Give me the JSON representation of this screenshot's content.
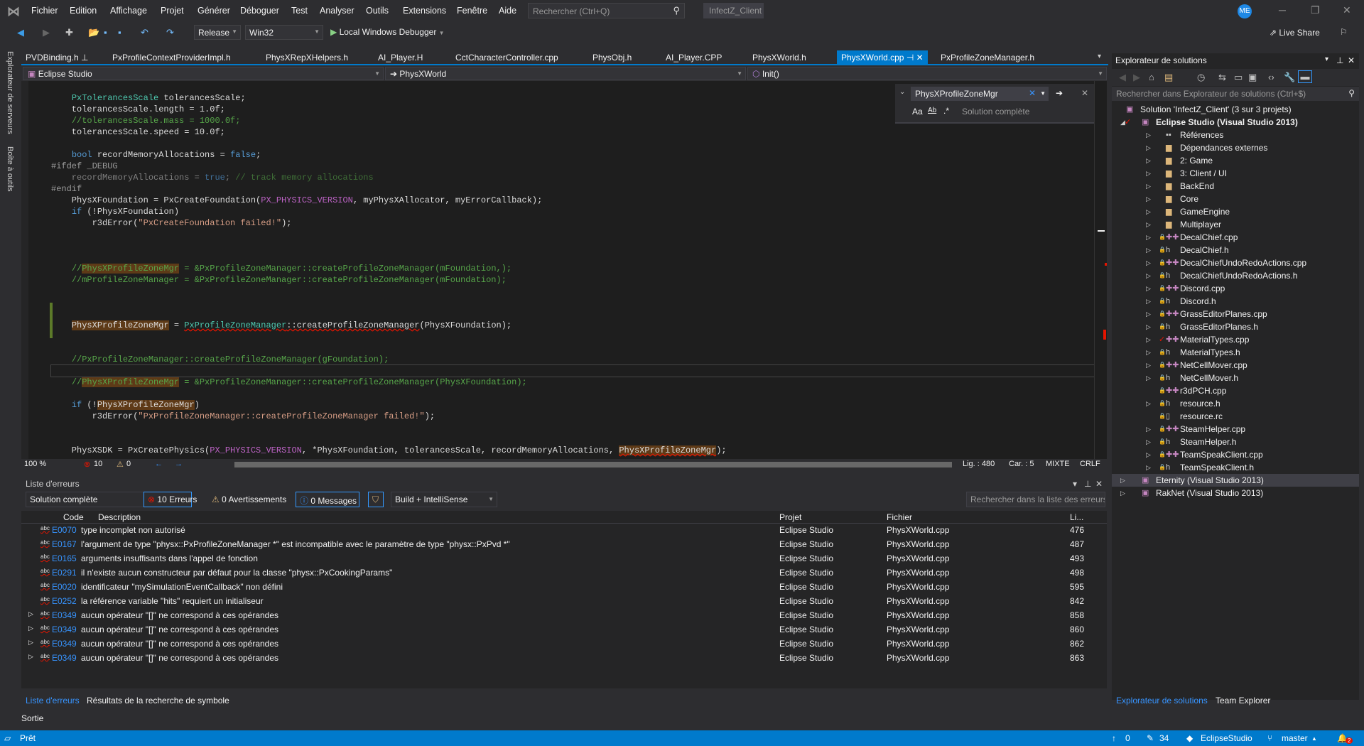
{
  "menubar": {
    "items": [
      "Fichier",
      "Edition",
      "Affichage",
      "Projet",
      "Générer",
      "Déboguer",
      "Test",
      "Analyser",
      "Outils",
      "Extensions",
      "Fenêtre",
      "Aide"
    ],
    "search_placeholder": "Rechercher (Ctrl+Q)",
    "solution_name": "InfectZ_Client",
    "avatar_initials": "ME"
  },
  "toolbar": {
    "configuration": "Release",
    "platform": "Win32",
    "debugger": "Local Windows Debugger",
    "live_share": "Live Share"
  },
  "left_strip": {
    "server_explorer": "Explorateur de serveurs",
    "toolbox": "Boîte à outils"
  },
  "tabs": [
    {
      "label": "PVDBinding.h",
      "pinned": true
    },
    {
      "label": "PxProfileContextProviderImpl.h"
    },
    {
      "label": "PhysXRepXHelpers.h"
    },
    {
      "label": "AI_Player.H"
    },
    {
      "label": "CctCharacterController.cpp"
    },
    {
      "label": "PhysObj.h"
    },
    {
      "label": "AI_Player.CPP"
    },
    {
      "label": "PhysXWorld.h"
    },
    {
      "label": "PhysXWorld.cpp",
      "active": true
    },
    {
      "label": "PxProfileZoneManager.h"
    }
  ],
  "navbar": {
    "project": "Eclipse Studio",
    "scope": "PhysXWorld",
    "member": "Init()"
  },
  "find": {
    "query": "PhysXProfileZoneMgr",
    "scope": "Solution complète",
    "match_case": "Aa",
    "whole_word": "Ab"
  },
  "code_lines": [
    [
      [
        "    ",
        ""
      ],
      [
        "PxTolerancesScale",
        "t-type"
      ],
      [
        " tolerancesScale;",
        "t-id"
      ]
    ],
    [
      [
        "    tolerancesScale.length = 1.0f;",
        "t-id"
      ]
    ],
    [
      [
        "    ",
        ""
      ],
      [
        "//tolerancesScale.mass = 1000.0f;",
        "t-cm"
      ]
    ],
    [
      [
        "    tolerancesScale.speed = 10.0f;",
        "t-id"
      ]
    ],
    [],
    [
      [
        "    ",
        ""
      ],
      [
        "bool",
        "t-kw"
      ],
      [
        " recordMemoryAllocations = ",
        "t-id"
      ],
      [
        "false",
        "t-kw"
      ],
      [
        ";",
        "t-id"
      ]
    ],
    [
      [
        "#ifdef _DEBUG",
        "t-pp"
      ]
    ],
    [
      [
        "    recordMemoryAllocations = ",
        "t-dim"
      ],
      [
        "true",
        "t-dimkw"
      ],
      [
        "; ",
        "t-dim"
      ],
      [
        "// track memory allocations",
        "t-dimcm"
      ]
    ],
    [
      [
        "#endif",
        "t-pp"
      ]
    ],
    [
      [
        "    PhysXFoundation = PxCreateFoundation(",
        "t-id"
      ],
      [
        "PX_PHYSICS_VERSION",
        "t-mac"
      ],
      [
        ", myPhysXAllocator, myErrorCallback);",
        "t-id"
      ]
    ],
    [
      [
        "    ",
        ""
      ],
      [
        "if",
        "t-kw"
      ],
      [
        " (!PhysXFoundation)",
        "t-id"
      ]
    ],
    [
      [
        "        r3dError(",
        "t-id"
      ],
      [
        "\"PxCreateFoundation failed!\"",
        "t-str"
      ],
      [
        ");",
        "t-id"
      ]
    ],
    [],
    [],
    [],
    [
      [
        "    ",
        ""
      ],
      [
        "//",
        "t-cm"
      ],
      [
        "PhysXProfileZoneMgr",
        "t-cm hl"
      ],
      [
        " = &PxProfileZoneManager::createProfileZoneManager(mFoundation,);",
        "t-cm"
      ]
    ],
    [
      [
        "    ",
        ""
      ],
      [
        "//mProfileZoneManager = &PxProfileZoneManager::createProfileZoneManager(mFoundation);",
        "t-cm"
      ]
    ],
    [],
    [],
    [],
    [
      [
        "    ",
        ""
      ],
      [
        "PhysXProfileZoneMgr",
        "t-id hl"
      ],
      [
        " = ",
        "t-id"
      ],
      [
        "PxProfileZoneManager",
        "t-type sq"
      ],
      [
        "::createProfileZoneManager",
        "t-id sq"
      ],
      [
        "(PhysXFoundation);",
        "t-id"
      ]
    ],
    [],
    [],
    [
      [
        "    ",
        ""
      ],
      [
        "//PxProfileZoneManager::createProfileZoneManager(gFoundation);",
        "t-cm"
      ]
    ],
    [],
    [
      [
        "    ",
        ""
      ],
      [
        "//",
        "t-cm"
      ],
      [
        "PhysXProfileZoneMgr",
        "t-cm hl"
      ],
      [
        " = &PxProfileZoneManager::createProfileZoneManager(PhysXFoundation);",
        "t-cm"
      ]
    ],
    [],
    [
      [
        "    ",
        ""
      ],
      [
        "if",
        "t-kw"
      ],
      [
        " (!",
        "t-id"
      ],
      [
        "PhysXProfileZoneMgr",
        "t-id hl"
      ],
      [
        ")",
        "t-id"
      ]
    ],
    [
      [
        "        r3dError(",
        "t-id"
      ],
      [
        "\"PxProfileZoneManager::createProfileZoneManager failed!\"",
        "t-str"
      ],
      [
        ");",
        "t-id"
      ]
    ],
    [],
    [],
    [
      [
        "    PhysXSDK = PxCreatePhysics(",
        "t-id"
      ],
      [
        "PX_PHYSICS_VERSION",
        "t-mac"
      ],
      [
        ", *PhysXFoundation, tolerancesScale, recordMemoryAllocations, ",
        "t-id"
      ],
      [
        "PhysXProfileZoneMgr",
        "t-id hl sq"
      ],
      [
        ");",
        "t-id"
      ]
    ]
  ],
  "editor_status": {
    "zoom": "100 %",
    "errors": "10",
    "warnings": "0",
    "line": "Lig. : 480",
    "col": "Car. : 5",
    "mode": "MIXTE",
    "eol": "CRLF"
  },
  "error_list": {
    "title": "Liste d'erreurs",
    "scope": "Solution complète",
    "errors_btn": "10 Erreurs",
    "warnings_btn": "0 Avertissements",
    "messages_btn": "0 Messages",
    "source": "Build + IntelliSense",
    "search_placeholder": "Rechercher dans la liste des erreurs",
    "columns": {
      "code": "Code",
      "description": "Description",
      "project": "Projet",
      "file": "Fichier",
      "line": "Li..."
    },
    "rows": [
      {
        "code": "E0070",
        "desc": "type incomplet non autorisé",
        "project": "Eclipse Studio",
        "file": "PhysXWorld.cpp",
        "line": "476"
      },
      {
        "code": "E0167",
        "desc": "l'argument de type \"physx::PxProfileZoneManager *\" est incompatible avec le paramètre de type \"physx::PxPvd *\"",
        "project": "Eclipse Studio",
        "file": "PhysXWorld.cpp",
        "line": "487"
      },
      {
        "code": "E0165",
        "desc": "arguments insuffisants dans l'appel de fonction",
        "project": "Eclipse Studio",
        "file": "PhysXWorld.cpp",
        "line": "493"
      },
      {
        "code": "E0291",
        "desc": "il n'existe aucun constructeur par défaut pour la classe \"physx::PxCookingParams\"",
        "project": "Eclipse Studio",
        "file": "PhysXWorld.cpp",
        "line": "498"
      },
      {
        "code": "E0020",
        "desc": "identificateur \"mySimulationEventCallback\" non défini",
        "project": "Eclipse Studio",
        "file": "PhysXWorld.cpp",
        "line": "595"
      },
      {
        "code": "E0252",
        "desc": "la référence variable \"hits\" requiert un initialiseur",
        "project": "Eclipse Studio",
        "file": "PhysXWorld.cpp",
        "line": "842"
      },
      {
        "code": "E0349",
        "desc": "aucun opérateur \"[]\" ne correspond à ces opérandes",
        "project": "Eclipse Studio",
        "file": "PhysXWorld.cpp",
        "line": "858",
        "expandable": true
      },
      {
        "code": "E0349",
        "desc": "aucun opérateur \"[]\" ne correspond à ces opérandes",
        "project": "Eclipse Studio",
        "file": "PhysXWorld.cpp",
        "line": "860",
        "expandable": true
      },
      {
        "code": "E0349",
        "desc": "aucun opérateur \"[]\" ne correspond à ces opérandes",
        "project": "Eclipse Studio",
        "file": "PhysXWorld.cpp",
        "line": "862",
        "expandable": true
      },
      {
        "code": "E0349",
        "desc": "aucun opérateur \"[]\" ne correspond à ces opérandes",
        "project": "Eclipse Studio",
        "file": "PhysXWorld.cpp",
        "line": "863",
        "expandable": true
      }
    ]
  },
  "bottom_tabs": {
    "errors": "Liste d'erreurs",
    "symbols": "Résultats de la recherche de symbole",
    "output": "Sortie"
  },
  "solution_explorer": {
    "title": "Explorateur de solutions",
    "search_placeholder": "Rechercher dans Explorateur de solutions (Ctrl+$)",
    "tree": [
      {
        "label": "Solution 'InfectZ_Client' (3 sur 3 projets)",
        "level": 0,
        "icon": "solution"
      },
      {
        "label": "Eclipse Studio (Visual Studio 2013)",
        "level": 1,
        "icon": "project",
        "expanded": true,
        "bold": true,
        "checked": true
      },
      {
        "label": "Références",
        "level": 2,
        "icon": "references",
        "arrow": true
      },
      {
        "label": "Dépendances externes",
        "level": 2,
        "icon": "external-deps",
        "arrow": true
      },
      {
        "label": "2: Game",
        "level": 2,
        "icon": "folder",
        "arrow": true
      },
      {
        "label": "3: Client  / UI",
        "level": 2,
        "icon": "folder",
        "arrow": true
      },
      {
        "label": "BackEnd",
        "level": 2,
        "icon": "folder",
        "arrow": true
      },
      {
        "label": "Core",
        "level": 2,
        "icon": "folder",
        "arrow": true
      },
      {
        "label": "GameEngine",
        "level": 2,
        "icon": "folder",
        "arrow": true
      },
      {
        "label": "Multiplayer",
        "level": 2,
        "icon": "folder",
        "arrow": true
      },
      {
        "label": "DecalChief.cpp",
        "level": 2,
        "icon": "cpp",
        "arrow": true,
        "lock": true
      },
      {
        "label": "DecalChief.h",
        "level": 2,
        "icon": "h",
        "arrow": true,
        "lock": true
      },
      {
        "label": "DecalChiefUndoRedoActions.cpp",
        "level": 2,
        "icon": "cpp",
        "arrow": true,
        "lock": true
      },
      {
        "label": "DecalChiefUndoRedoActions.h",
        "level": 2,
        "icon": "h",
        "arrow": true,
        "lock": true
      },
      {
        "label": "Discord.cpp",
        "level": 2,
        "icon": "cpp",
        "arrow": true,
        "lock": true
      },
      {
        "label": "Discord.h",
        "level": 2,
        "icon": "h",
        "arrow": true,
        "lock": true
      },
      {
        "label": "GrassEditorPlanes.cpp",
        "level": 2,
        "icon": "cpp",
        "arrow": true,
        "lock": true
      },
      {
        "label": "GrassEditorPlanes.h",
        "level": 2,
        "icon": "h",
        "arrow": true,
        "lock": true
      },
      {
        "label": "MaterialTypes.cpp",
        "level": 2,
        "icon": "cpp",
        "arrow": true,
        "checked": true
      },
      {
        "label": "MaterialTypes.h",
        "level": 2,
        "icon": "h",
        "arrow": true,
        "lock": true
      },
      {
        "label": "NetCellMover.cpp",
        "level": 2,
        "icon": "cpp",
        "arrow": true,
        "lock": true
      },
      {
        "label": "NetCellMover.h",
        "level": 2,
        "icon": "h",
        "arrow": true,
        "lock": true
      },
      {
        "label": "r3dPCH.cpp",
        "level": 2,
        "icon": "cpp",
        "lock": true
      },
      {
        "label": "resource.h",
        "level": 2,
        "icon": "h",
        "arrow": true,
        "lock": true
      },
      {
        "label": "resource.rc",
        "level": 2,
        "icon": "rc",
        "lock": true
      },
      {
        "label": "SteamHelper.cpp",
        "level": 2,
        "icon": "cpp",
        "arrow": true,
        "lock": true
      },
      {
        "label": "SteamHelper.h",
        "level": 2,
        "icon": "h",
        "arrow": true,
        "lock": true
      },
      {
        "label": "TeamSpeakClient.cpp",
        "level": 2,
        "icon": "cpp",
        "arrow": true,
        "lock": true
      },
      {
        "label": "TeamSpeakClient.h",
        "level": 2,
        "icon": "h",
        "arrow": true,
        "lock": true
      },
      {
        "label": "Eternity (Visual Studio 2013)",
        "level": 1,
        "icon": "project",
        "arrow": true,
        "highlighted": true
      },
      {
        "label": "RakNet (Visual Studio 2013)",
        "level": 1,
        "icon": "project",
        "arrow": true
      }
    ],
    "tabs": {
      "solution": "Explorateur de solutions",
      "team": "Team Explorer"
    }
  },
  "statusbar": {
    "ready": "Prêt",
    "push": "0",
    "changes": "34",
    "repo": "EclipseStudio",
    "branch": "master",
    "notifications": "2"
  },
  "colors": {
    "accent": "#007acc",
    "editor_bg": "#1e1e1e",
    "chrome_bg": "#2d2d30",
    "error": "#e51400"
  }
}
